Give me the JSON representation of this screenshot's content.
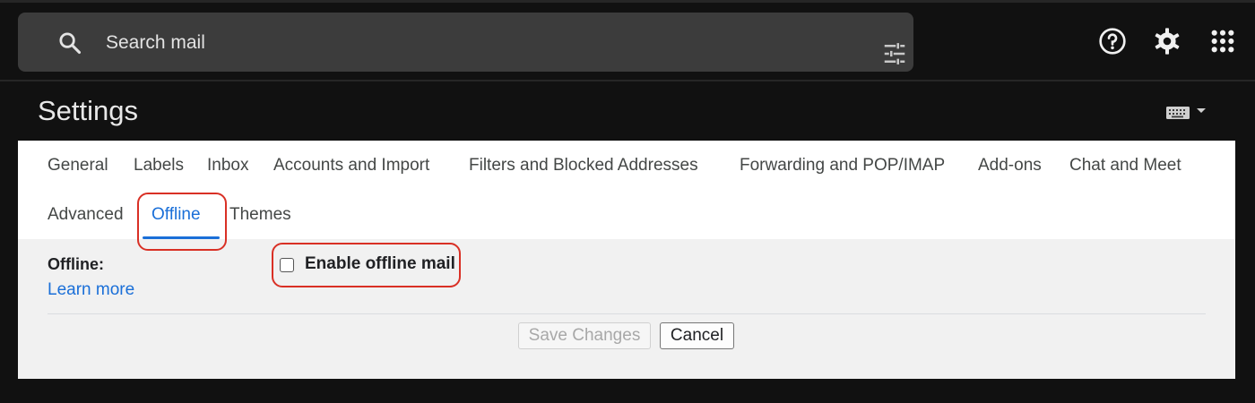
{
  "search": {
    "placeholder": "Search mail",
    "icon": "search-icon",
    "filter_icon": "tune-icon"
  },
  "header_icons": [
    "help-icon",
    "settings-gear-icon",
    "apps-grid-icon"
  ],
  "page": {
    "title": "Settings",
    "input_tools_icon": "keyboard-icon"
  },
  "tabs": [
    {
      "label": "General"
    },
    {
      "label": "Labels"
    },
    {
      "label": "Inbox"
    },
    {
      "label": "Accounts and Import"
    },
    {
      "label": "Filters and Blocked Addresses"
    },
    {
      "label": "Forwarding and POP/IMAP"
    },
    {
      "label": "Add-ons"
    },
    {
      "label": "Chat and Meet"
    },
    {
      "label": "Advanced"
    },
    {
      "label": "Offline",
      "active": true
    },
    {
      "label": "Themes"
    }
  ],
  "offline": {
    "section_label": "Offline:",
    "learn_more": "Learn more",
    "checkbox_label": "Enable offline mail",
    "checked": false
  },
  "actions": {
    "save": "Save Changes",
    "save_disabled": true,
    "cancel": "Cancel"
  },
  "colors": {
    "background": "#111111",
    "search_bar": "#3c3c3c",
    "accent": "#1a6fd8",
    "highlight": "#d93025"
  }
}
